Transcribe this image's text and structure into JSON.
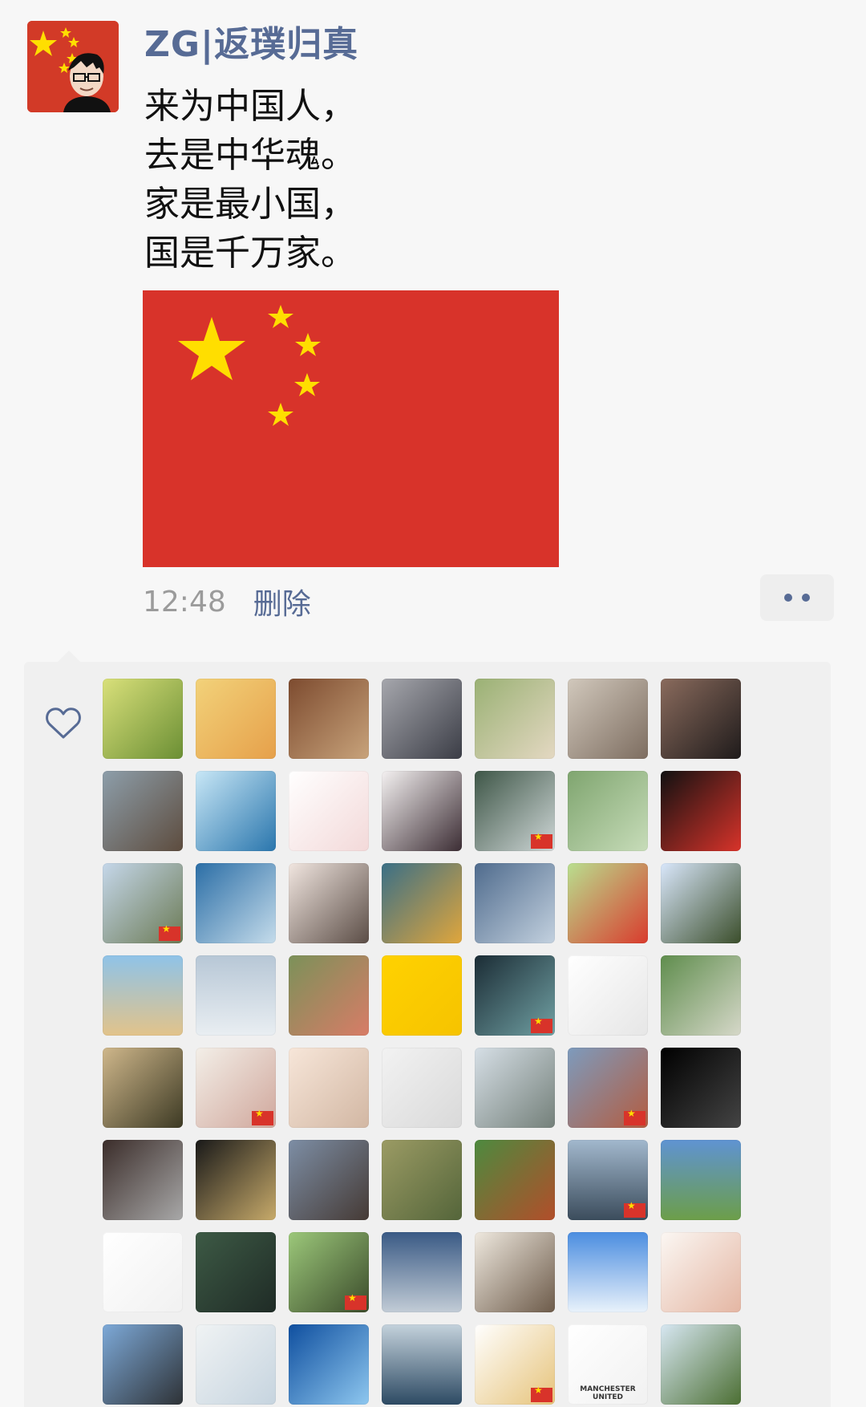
{
  "post": {
    "author": "ZG|返璞归真",
    "lines": [
      "来为中国人，",
      "去是中华魂。",
      "家是最小国，",
      "国是千万家。"
    ],
    "time": "12:48",
    "delete_label": "删除"
  },
  "likes": {
    "avatars": [
      {
        "bg": "linear-gradient(135deg,#d9e07a,#6b8f34)",
        "flag": false
      },
      {
        "bg": "linear-gradient(135deg,#f2d27a,#e6a04a)",
        "flag": false
      },
      {
        "bg": "linear-gradient(135deg,#7d4b2f,#c8a37b)",
        "flag": false
      },
      {
        "bg": "linear-gradient(135deg,#a6a7ad,#3b3d46)",
        "flag": false
      },
      {
        "bg": "linear-gradient(135deg,#9ab174,#e4d8c2)",
        "flag": false
      },
      {
        "bg": "linear-gradient(135deg,#d1c8bc,#7d6d60)",
        "flag": false
      },
      {
        "bg": "linear-gradient(135deg,#8a6b5d,#1f1b1b)",
        "flag": false
      },
      {
        "bg": "linear-gradient(135deg,#8d9eaa,#5d4c3e)",
        "flag": false
      },
      {
        "bg": "linear-gradient(135deg,#c8e7f6,#2a76ad)",
        "flag": false
      },
      {
        "bg": "linear-gradient(135deg,#ffffff,#f3d9d9)",
        "flag": false
      },
      {
        "bg": "linear-gradient(135deg,#f4f1f1,#3c2d34)",
        "flag": false
      },
      {
        "bg": "linear-gradient(135deg,#3e5647,#cfd7d7)",
        "flag": true
      },
      {
        "bg": "linear-gradient(135deg,#7fa56f,#c7dcb9)",
        "flag": false
      },
      {
        "bg": "linear-gradient(135deg,#111111,#d8332a)",
        "flag": false
      },
      {
        "bg": "linear-gradient(135deg,#c5d7ea,#6b7a54)",
        "flag": true
      },
      {
        "bg": "linear-gradient(135deg,#2b6ea6,#c5dceb)",
        "flag": false
      },
      {
        "bg": "linear-gradient(135deg,#f1e6e0,#5b4d46)",
        "flag": false
      },
      {
        "bg": "linear-gradient(135deg,#3a6f86,#e0a63c)",
        "flag": false
      },
      {
        "bg": "linear-gradient(135deg,#4f6b8d,#c3d1df)",
        "flag": false
      },
      {
        "bg": "linear-gradient(135deg,#b9df8f,#d93b2d)",
        "flag": false
      },
      {
        "bg": "linear-gradient(135deg,#d9e7fb,#3b4e2b)",
        "flag": false
      },
      {
        "bg": "linear-gradient(180deg,#8fc3e8,#e2c38a)",
        "flag": false
      },
      {
        "bg": "linear-gradient(180deg,#b7c7d6,#e9eef2)",
        "flag": false
      },
      {
        "bg": "linear-gradient(135deg,#7b9159,#d87c67)",
        "flag": false
      },
      {
        "bg": "linear-gradient(135deg,#ffd200,#f6c300)",
        "flag": false
      },
      {
        "bg": "linear-gradient(135deg,#1b2c35,#71a1a4)",
        "flag": true
      },
      {
        "bg": "linear-gradient(135deg,#ffffff,#e6e6e6)",
        "flag": false
      },
      {
        "bg": "linear-gradient(135deg,#5f8d4d,#d6d8c9)",
        "flag": false
      },
      {
        "bg": "linear-gradient(135deg,#cfb78b,#3d3a24)",
        "flag": false
      },
      {
        "bg": "linear-gradient(135deg,#f3efe8,#d0a79c)",
        "flag": true
      },
      {
        "bg": "linear-gradient(135deg,#f7e6d9,#d2b7a3)",
        "flag": false
      },
      {
        "bg": "linear-gradient(135deg,#f2f2f2,#d9d9d9)",
        "flag": false
      },
      {
        "bg": "linear-gradient(135deg,#d6dfe6,#74807a)",
        "flag": false
      },
      {
        "bg": "linear-gradient(135deg,#7d9bbd,#b35c40)",
        "flag": true
      },
      {
        "bg": "linear-gradient(135deg,#000000,#444444)",
        "flag": false
      },
      {
        "bg": "linear-gradient(135deg,#3b2d2a,#a8a8a8)",
        "flag": false
      },
      {
        "bg": "linear-gradient(135deg,#191919,#c7aa6a)",
        "flag": false
      },
      {
        "bg": "linear-gradient(135deg,#7d8ea5,#453a35)",
        "flag": false
      },
      {
        "bg": "linear-gradient(135deg,#9b9b64,#54653a)",
        "flag": false
      },
      {
        "bg": "linear-gradient(135deg,#4d8a3f,#b24e2a)",
        "flag": false
      },
      {
        "bg": "linear-gradient(180deg,#a2b8cd,#3b4c5c)",
        "flag": true
      },
      {
        "bg": "linear-gradient(180deg,#5f93d2,#6c9e49)",
        "flag": false
      },
      {
        "bg": "linear-gradient(135deg,#ffffff,#f1f1f1)",
        "flag": false
      },
      {
        "bg": "linear-gradient(135deg,#3d5a45,#1f2b26)",
        "flag": false
      },
      {
        "bg": "linear-gradient(135deg,#9cc87a,#3b4b2b)",
        "flag": true
      },
      {
        "bg": "linear-gradient(180deg,#3a5a85,#c2ccd6)",
        "flag": false
      },
      {
        "bg": "linear-gradient(135deg,#efe9df,#6d5b4a)",
        "flag": false
      },
      {
        "bg": "linear-gradient(180deg,#4b8de0,#e9f2fb)",
        "flag": false
      },
      {
        "bg": "linear-gradient(135deg,#fbf7f3,#e4b6a3)",
        "flag": false
      },
      {
        "bg": "linear-gradient(135deg,#7da9d8,#2e3236)",
        "flag": false
      },
      {
        "bg": "linear-gradient(135deg,#f0f3f4,#c6d4df)",
        "flag": false
      },
      {
        "bg": "linear-gradient(135deg,#0f4f9f,#8ec7ef)",
        "flag": false
      },
      {
        "bg": "linear-gradient(180deg,#c4d2dc,#2d4a63)",
        "flag": false
      },
      {
        "bg": "linear-gradient(135deg,#ffffff,#e6c37a)",
        "flag": true
      },
      {
        "bg": "linear-gradient(135deg,#ffffff,#f1f1f1)",
        "flag": false,
        "text": "MANCHESTER UNITED"
      },
      {
        "bg": "linear-gradient(135deg,#d7e7f2,#4c6f33)",
        "flag": false
      }
    ]
  }
}
